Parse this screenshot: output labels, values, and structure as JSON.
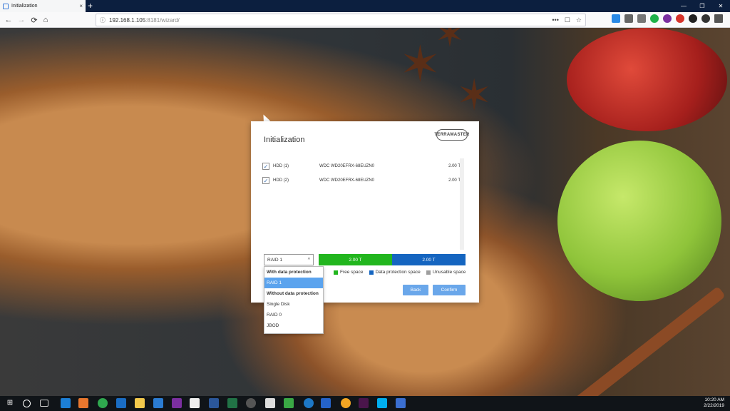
{
  "browser": {
    "tab_title": "Initialization",
    "tab_close": "×",
    "new_tab": "+",
    "window_controls": [
      "—",
      "❐",
      "✕"
    ],
    "nav": {
      "back": "←",
      "forward": "→",
      "reload": "⟳",
      "home": "⌂"
    },
    "url_host": "192.168.1.105",
    "url_path": ":8181/wizard/",
    "url_actions": [
      "•••",
      "☐",
      "☆"
    ]
  },
  "dialog": {
    "title": "Initialization",
    "logo_text": "TERRAMASTER",
    "disks": [
      {
        "checked": "✓",
        "name": "HDD (1)",
        "model": "WDC WD20EFRX-68EUZN0",
        "size": "2.00 T"
      },
      {
        "checked": "✓",
        "name": "HDD (2)",
        "model": "WDC WD20EFRX-68EUZN0",
        "size": "2.00 T"
      }
    ],
    "raid_select": {
      "value": "RAID 1",
      "chevron": "^"
    },
    "bar": {
      "free_label": "2.00 T",
      "protection_label": "2.00 T"
    },
    "legend": {
      "free": "Free space",
      "protection": "Data protection space",
      "unusable": "Unusable space"
    },
    "colors": {
      "free": "#22b61e",
      "protection": "#1565c0",
      "unusable": "#9e9e9e"
    },
    "buttons": {
      "back": "Back",
      "confirm": "Confirm"
    }
  },
  "dropdown": {
    "items": [
      {
        "label": "With data protection",
        "kind": "group"
      },
      {
        "label": "RAID 1",
        "kind": "selected"
      },
      {
        "label": "Without data protection",
        "kind": "group"
      },
      {
        "label": "Single Disk",
        "kind": "option"
      },
      {
        "label": "RAID 0",
        "kind": "option"
      },
      {
        "label": "JBOD",
        "kind": "option"
      }
    ]
  },
  "taskbar": {
    "time": "10:20 AM",
    "date": "2/22/2019"
  }
}
